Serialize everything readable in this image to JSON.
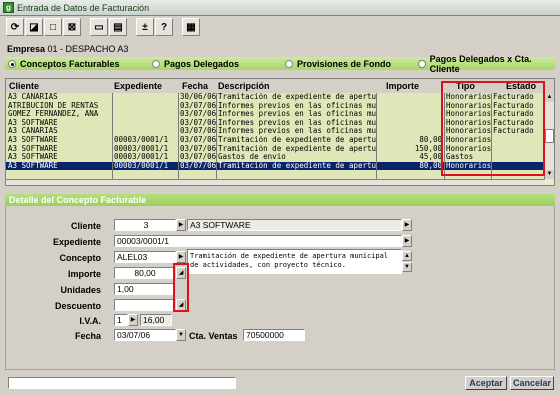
{
  "window": {
    "title": "Entrada de Datos de Facturación"
  },
  "toolbar": {
    "icons": [
      "refresh-icon",
      "edit-icon",
      "stop-icon",
      "close-icon",
      "print-icon",
      "list-icon",
      "plus-minus-icon",
      "help-icon",
      "calculator-icon"
    ],
    "glyphs": [
      "⟳",
      "◪",
      "□",
      "⊠",
      "▭",
      "▤",
      "±",
      "?",
      "▦"
    ]
  },
  "empresa": {
    "label": "Empresa",
    "value": "01 - DESPACHO A3"
  },
  "tabs": [
    {
      "label": "Conceptos Facturables",
      "selected": true
    },
    {
      "label": "Pagos Delegados",
      "selected": false
    },
    {
      "label": "Provisiones de Fondo",
      "selected": false
    },
    {
      "label": "Pagos Delegados x Cta. Cliente",
      "selected": false
    }
  ],
  "grid": {
    "columns": [
      "Cliente",
      "Expediente",
      "Fecha",
      "Descripción",
      "Importe",
      "Tipo",
      "Estado"
    ],
    "rows": [
      {
        "cliente": "A3 CANARIAS",
        "expediente": "",
        "fecha": "30/06/06",
        "descripcion": "Tramitación de expediente de apertura",
        "importe": "",
        "tipo": "Honorarios",
        "estado": "Facturado"
      },
      {
        "cliente": "ATRIBUCION DE RENTAS",
        "expediente": "",
        "fecha": "03/07/06",
        "descripcion": "Informes previos en las oficinas muni",
        "importe": "",
        "tipo": "Honorarios",
        "estado": "Facturado"
      },
      {
        "cliente": "GOMEZ FERNANDEZ, ANA",
        "expediente": "",
        "fecha": "03/07/06",
        "descripcion": "Informes previos en las oficinas muni",
        "importe": "",
        "tipo": "Honorarios",
        "estado": "Facturado"
      },
      {
        "cliente": "A3 SOFTWARE",
        "expediente": "",
        "fecha": "03/07/06",
        "descripcion": "Informes previos en las oficinas muni",
        "importe": "",
        "tipo": "Honorarios",
        "estado": "Facturado"
      },
      {
        "cliente": "A3 CANARIAS",
        "expediente": "",
        "fecha": "03/07/06",
        "descripcion": "Informes previos en las oficinas muni",
        "importe": "",
        "tipo": "Honorarios",
        "estado": "Facturado"
      },
      {
        "cliente": "A3 SOFTWARE",
        "expediente": "00003/0001/1",
        "fecha": "03/07/06",
        "descripcion": "Tramitación de expediente de apertura",
        "importe": "80,00",
        "tipo": "Honorarios",
        "estado": ""
      },
      {
        "cliente": "A3 SOFTWARE",
        "expediente": "00003/0001/1",
        "fecha": "03/07/06",
        "descripcion": "Tramitación de expediente de apertura",
        "importe": "150,00",
        "tipo": "Honorarios",
        "estado": ""
      },
      {
        "cliente": "A3 SOFTWARE",
        "expediente": "00003/0001/1",
        "fecha": "03/07/06",
        "descripcion": "Gastos de envío",
        "importe": "45,00",
        "tipo": "Gastos",
        "estado": ""
      },
      {
        "cliente": "A3 SOFTWARE",
        "expediente": "00003/0001/1",
        "fecha": "03/07/06",
        "descripcion": "Tramitación de expediente de apertura",
        "importe": "80,00",
        "tipo": "Honorarios",
        "estado": ""
      }
    ],
    "selected_row": 8
  },
  "detail": {
    "title": "Detalle del Concepto Facturable",
    "cliente": {
      "label": "Cliente",
      "code": "3",
      "name": "A3 SOFTWARE"
    },
    "expediente": {
      "label": "Expediente",
      "value": "00003/0001/1"
    },
    "concepto": {
      "label": "Concepto",
      "value": "ALEL03",
      "description": "Tramitación de expediente de apertura municipal de actividades, con proyecto técnico."
    },
    "importe": {
      "label": "Importe",
      "value": "80,00"
    },
    "unidades": {
      "label": "Unidades",
      "value": "1,00"
    },
    "descuento": {
      "label": "Descuento",
      "value": ""
    },
    "iva": {
      "label": "I.V.A.",
      "code": "1",
      "value": "16,00"
    },
    "fecha": {
      "label": "Fecha",
      "value": "03/07/06"
    },
    "cta_ventas": {
      "label": "Cta. Ventas",
      "value": "70500000"
    }
  },
  "buttons": {
    "accept": "Aceptar",
    "cancel": "Cancelar"
  }
}
